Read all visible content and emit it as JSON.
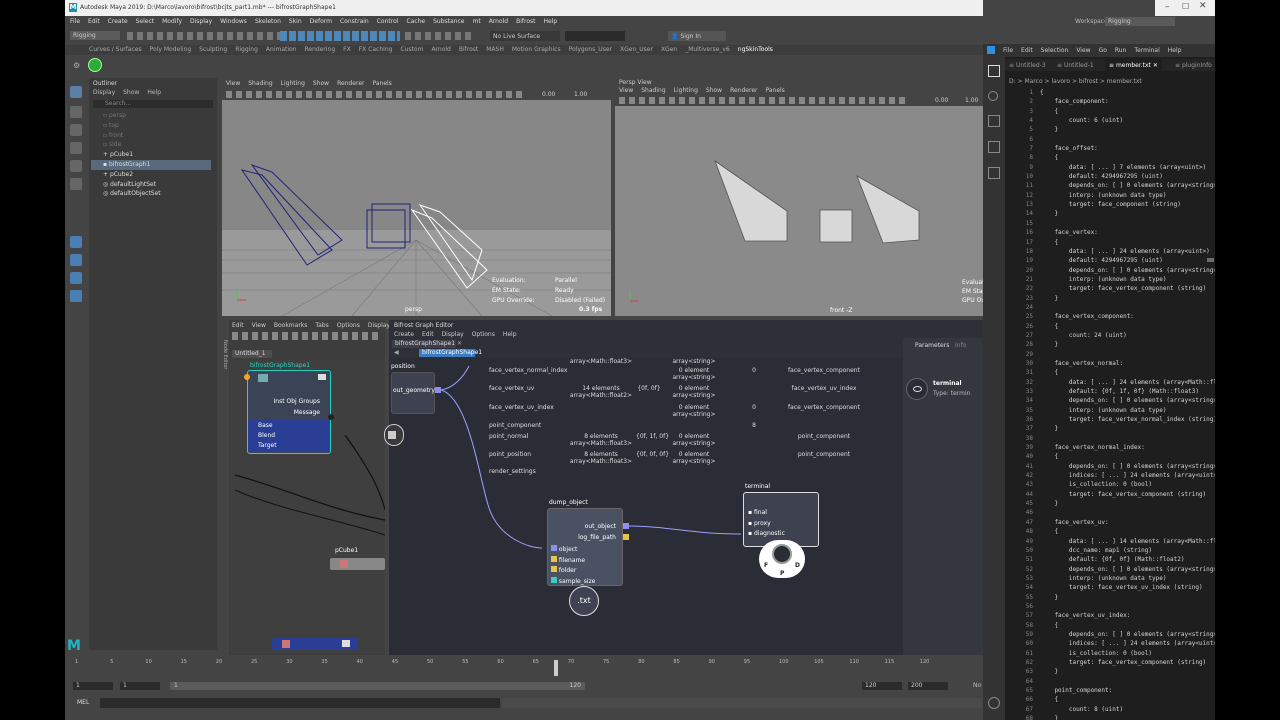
{
  "maya": {
    "title": "Autodesk Maya 2019: D:\\Marco\\lavoro\\bifrost\\bcjts_part1.mb* --- bifrostGraphShape1",
    "menu": [
      "File",
      "Edit",
      "Create",
      "Select",
      "Modify",
      "Display",
      "Windows",
      "Skeleton",
      "Skin",
      "Deform",
      "Constrain",
      "Control",
      "Cache",
      "Substance",
      "mt",
      "Arnold",
      "Bifrost",
      "Help"
    ],
    "workspace_label": "Workspace :",
    "workspace_value": "Rigging",
    "mode_value": "Rigging",
    "live_surface": "No Live Surface",
    "sign_in": "Sign In",
    "shelf_tabs": [
      "Curves / Surfaces",
      "Poly Modeling",
      "Sculpting",
      "Rigging",
      "Animation",
      "Rendering",
      "FX",
      "FX Caching",
      "Custom",
      "Arnold",
      "Bifrost",
      "MASH",
      "Motion Graphics",
      "Polygons_User",
      "XGen_User",
      "XGen",
      "_Multiverse_v6",
      "ngSkinTools"
    ],
    "outliner": {
      "title": "Outliner",
      "menu": [
        "Display",
        "Show",
        "Help"
      ],
      "search": "Search...",
      "items": [
        "persp",
        "top",
        "front",
        "side",
        "pCube1",
        "bifrostGraph1",
        "pCube2",
        "defaultLightSet",
        "defaultObjectSet"
      ]
    },
    "viewport_menu": [
      "View",
      "Shading",
      "Lighting",
      "Show",
      "Renderer",
      "Panels"
    ],
    "vp_left": {
      "gamma": "0.00",
      "exposure": "1.00",
      "camera": "persp",
      "hud": [
        [
          "Evaluation:",
          "Parallel"
        ],
        [
          "EM State:",
          "Ready"
        ],
        [
          "GPU Override:",
          "Disabled (Failed)"
        ]
      ],
      "fps": "0.3 fps"
    },
    "vp_right": {
      "title": "Persp View",
      "gamma": "0.00",
      "exposure": "1.00",
      "camera": "front -Z",
      "hud_clip": [
        "Evaluat",
        "EM Stat",
        "GPU Ov"
      ]
    },
    "node_editor": {
      "menu": [
        "Edit",
        "View",
        "Bookmarks",
        "Tabs",
        "Options",
        "Display"
      ],
      "tab": "Untitled_1",
      "side_label": "Node Editor",
      "graph_node": {
        "title": "bifrostGraphShape1",
        "ports": [
          "Inst Obj Groups",
          "Message"
        ],
        "inputs": [
          "Base",
          "Blend",
          "Target"
        ]
      },
      "pcube_label": "pCube1",
      "bottom_label": "bifrostGraph1"
    },
    "bifrost": {
      "title": "Bifrost Graph Editor",
      "menu": [
        "Create",
        "Edit",
        "Display",
        "Options",
        "Help"
      ],
      "tab": "bifrostGraphShape1",
      "breadcrumb": "bifrostGraphShape1",
      "params_tab": "Parameters",
      "info_tab": "Info",
      "position_node": {
        "title": "position",
        "port": "out_geometry"
      },
      "watch_rows": [
        [
          "",
          "array<Math::float3>",
          "",
          "array<string>",
          "",
          ""
        ],
        [
          "face_vertex_normal_index",
          "",
          "",
          "0 element\narray<string>",
          "0",
          "face_vertex_component"
        ],
        [
          "face_vertex_uv",
          "14 elements\narray<Math::float2>",
          "{0f, 0f}",
          "0 element\narray<string>",
          "",
          "face_vertex_uv_index"
        ],
        [
          "face_vertex_uv_index",
          "",
          "",
          "0 element\narray<string>",
          "0",
          "face_vertex_component"
        ],
        [
          "point_component",
          "",
          "",
          "",
          "8",
          ""
        ],
        [
          "point_normal",
          "8 elements\narray<Math::float3>",
          "{0f, 1f, 0f}",
          "0 element\narray<string>",
          "",
          "point_component"
        ],
        [
          "point_position",
          "8 elements\narray<Math::float3>",
          "{0f, 0f, 0f}",
          "0 element\narray<string>",
          "",
          "point_component"
        ],
        [
          "render_settings",
          "",
          "",
          "",
          "",
          ""
        ]
      ],
      "dump_node": {
        "title": "dump_object",
        "outputs": [
          "out_object",
          "log_file_path"
        ],
        "inputs": [
          "object",
          "filename",
          "folder",
          "sample_size"
        ],
        "icon_text": ".txt"
      },
      "terminal_node": {
        "title": "terminal",
        "ports": [
          "final",
          "proxy",
          "diagnostic"
        ],
        "letters": [
          "F",
          "D",
          "P"
        ]
      },
      "terminal_panel": {
        "title": "terminal",
        "type": "Type: termin"
      }
    },
    "timeline": {
      "ticks": [
        "1",
        "5",
        "10",
        "15",
        "20",
        "25",
        "30",
        "35",
        "40",
        "45",
        "50",
        "55",
        "60",
        "65",
        "70",
        "75",
        "80",
        "85",
        "90",
        "95",
        "100",
        "105",
        "110",
        "115",
        "120"
      ]
    },
    "range": {
      "start": "1",
      "cur": "1",
      "slider_start": "1",
      "slider_end": "120",
      "end": "120",
      "max": "200",
      "nc": "No"
    },
    "mel": "MEL"
  },
  "vscode": {
    "menu": [
      "File",
      "Edit",
      "Selection",
      "View",
      "Go",
      "Run",
      "Terminal",
      "Help"
    ],
    "tabs": [
      "Untitled-3",
      "Untitled-1",
      "member.txt",
      "pluginInfo"
    ],
    "breadcrumb": "D: > Marco > lavoro > bifrost > member.txt",
    "start_line": 1,
    "lines": [
      "{",
      "    face_component:",
      "    {",
      "        count: 6 (uint)",
      "    }",
      "",
      "    face_offset:",
      "    {",
      "        data: [ ... ] 7 elements (array<uint>)",
      "        default: 4294967295 (uint)",
      "        depends_on: [ ] 0 elements (array<string>)",
      "        interp: (unknown data type)",
      "        target: face_component (string)",
      "    }",
      "",
      "    face_vertex:",
      "    {",
      "        data: [ ... ] 24 elements (array<uint>)",
      "        default: 4294967295 (uint)",
      "        depends_on: [ ] 0 elements (array<string>)",
      "        interp: (unknown data type)",
      "        target: face_vertex_component (string)",
      "    }",
      "",
      "    face_vertex_component:",
      "    {",
      "        count: 24 (uint)",
      "    }",
      "",
      "    face_vertex_normal:",
      "    {",
      "        data: [ ... ] 24 elements (array<Math::float3>)",
      "        default: {0f, 1f, 0f} (Math::float3)",
      "        depends_on: [ ] 0 elements (array<string>)",
      "        interp: (unknown data type)",
      "        target: face_vertex_normal_index (string)",
      "    }",
      "",
      "    face_vertex_normal_index:",
      "    {",
      "        depends_on: [ ] 0 elements (array<string>)",
      "        indices: [ ... ] 24 elements (array<uint>)",
      "        is_collection: 0 (bool)",
      "        target: face_vertex_component (string)",
      "    }",
      "",
      "    face_vertex_uv:",
      "    {",
      "        data: [ ... ] 14 elements (array<Math::float2>)",
      "        dcc_name: map1 (string)",
      "        default: {0f, 0f} (Math::float2)",
      "        depends_on: [ ] 0 elements (array<string>)",
      "        interp: (unknown data type)",
      "        target: face_vertex_uv_index (string)",
      "    }",
      "",
      "    face_vertex_uv_index:",
      "    {",
      "        depends_on: [ ] 0 elements (array<string>)",
      "        indices: [ ... ] 24 elements (array<uint>)",
      "        is_collection: 0 (bool)",
      "        target: face_vertex_component (string)",
      "    }",
      "",
      "    point_component:",
      "    {",
      "        count: 8 (uint)",
      "    }"
    ]
  }
}
